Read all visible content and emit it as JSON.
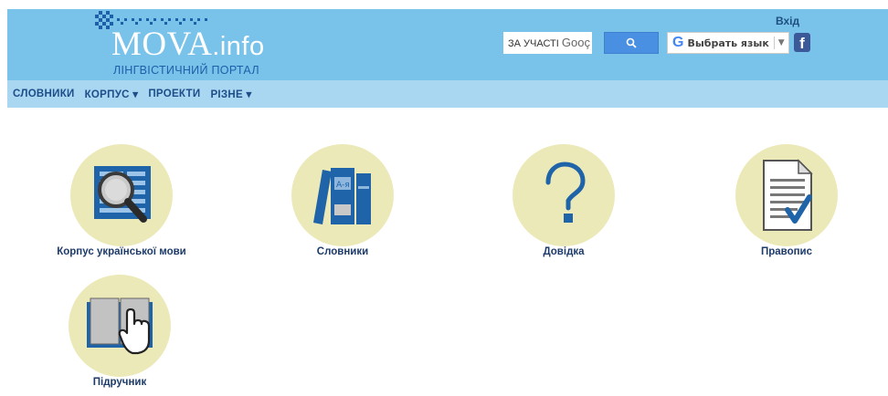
{
  "header": {
    "logo_main": "MOVA",
    "logo_suffix": ".info",
    "logo_subtitle": "ЛІНГВІСТИЧНИЙ ПОРТАЛ",
    "login": "Вхід",
    "search": {
      "prefix": "ЗА УЧАСТІ",
      "brand": "Gooç"
    },
    "translate": {
      "label": "Выбрать язык",
      "g": "G"
    },
    "colors": {
      "header_bg": "#79c3ea",
      "nav_bg": "#a9d6f0",
      "accent": "#4a90e2"
    }
  },
  "nav": {
    "items": [
      {
        "label": "СЛОВНИКИ"
      },
      {
        "label": "КОРПУС ▾"
      },
      {
        "label": "ПРОЕКТИ"
      },
      {
        "label": "РІЗНЕ ▾"
      }
    ]
  },
  "tiles": [
    {
      "label": "Корпус української мови",
      "icon": "magnifier-corpus-icon"
    },
    {
      "label": "Словники",
      "icon": "books-icon"
    },
    {
      "label": "Довідка",
      "icon": "question-mark-icon"
    },
    {
      "label": "Правопис",
      "icon": "document-check-icon"
    },
    {
      "label": "Підручник",
      "icon": "open-book-hand-icon"
    }
  ]
}
